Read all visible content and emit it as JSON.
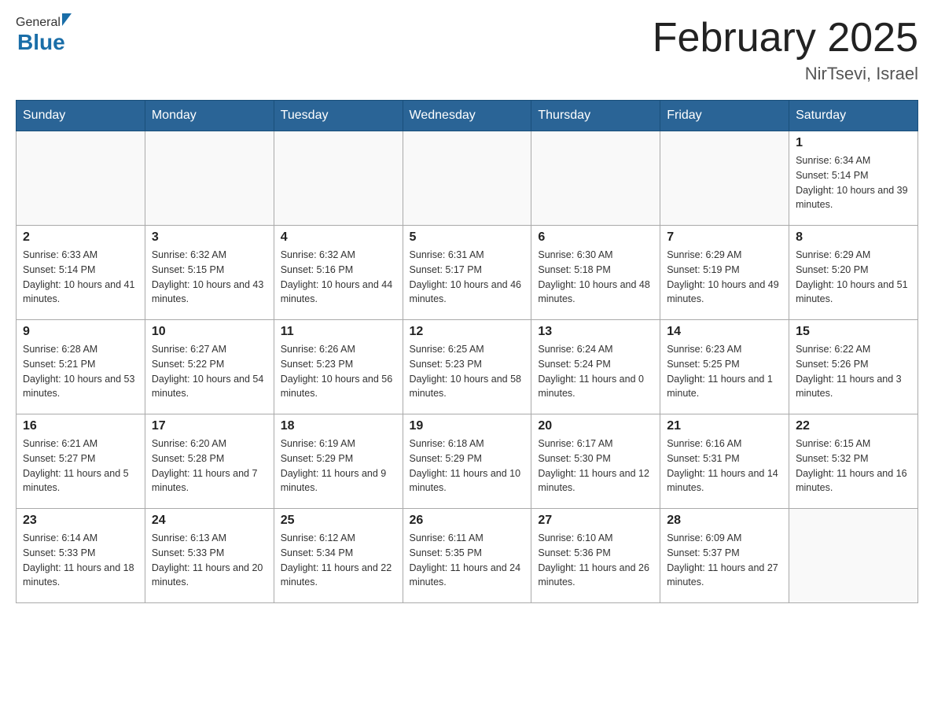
{
  "header": {
    "title": "February 2025",
    "subtitle": "NirTsevi, Israel",
    "logo_general": "General",
    "logo_blue": "Blue"
  },
  "weekdays": [
    "Sunday",
    "Monday",
    "Tuesday",
    "Wednesday",
    "Thursday",
    "Friday",
    "Saturday"
  ],
  "weeks": [
    [
      {
        "day": "",
        "sunrise": "",
        "sunset": "",
        "daylight": ""
      },
      {
        "day": "",
        "sunrise": "",
        "sunset": "",
        "daylight": ""
      },
      {
        "day": "",
        "sunrise": "",
        "sunset": "",
        "daylight": ""
      },
      {
        "day": "",
        "sunrise": "",
        "sunset": "",
        "daylight": ""
      },
      {
        "day": "",
        "sunrise": "",
        "sunset": "",
        "daylight": ""
      },
      {
        "day": "",
        "sunrise": "",
        "sunset": "",
        "daylight": ""
      },
      {
        "day": "1",
        "sunrise": "Sunrise: 6:34 AM",
        "sunset": "Sunset: 5:14 PM",
        "daylight": "Daylight: 10 hours and 39 minutes."
      }
    ],
    [
      {
        "day": "2",
        "sunrise": "Sunrise: 6:33 AM",
        "sunset": "Sunset: 5:14 PM",
        "daylight": "Daylight: 10 hours and 41 minutes."
      },
      {
        "day": "3",
        "sunrise": "Sunrise: 6:32 AM",
        "sunset": "Sunset: 5:15 PM",
        "daylight": "Daylight: 10 hours and 43 minutes."
      },
      {
        "day": "4",
        "sunrise": "Sunrise: 6:32 AM",
        "sunset": "Sunset: 5:16 PM",
        "daylight": "Daylight: 10 hours and 44 minutes."
      },
      {
        "day": "5",
        "sunrise": "Sunrise: 6:31 AM",
        "sunset": "Sunset: 5:17 PM",
        "daylight": "Daylight: 10 hours and 46 minutes."
      },
      {
        "day": "6",
        "sunrise": "Sunrise: 6:30 AM",
        "sunset": "Sunset: 5:18 PM",
        "daylight": "Daylight: 10 hours and 48 minutes."
      },
      {
        "day": "7",
        "sunrise": "Sunrise: 6:29 AM",
        "sunset": "Sunset: 5:19 PM",
        "daylight": "Daylight: 10 hours and 49 minutes."
      },
      {
        "day": "8",
        "sunrise": "Sunrise: 6:29 AM",
        "sunset": "Sunset: 5:20 PM",
        "daylight": "Daylight: 10 hours and 51 minutes."
      }
    ],
    [
      {
        "day": "9",
        "sunrise": "Sunrise: 6:28 AM",
        "sunset": "Sunset: 5:21 PM",
        "daylight": "Daylight: 10 hours and 53 minutes."
      },
      {
        "day": "10",
        "sunrise": "Sunrise: 6:27 AM",
        "sunset": "Sunset: 5:22 PM",
        "daylight": "Daylight: 10 hours and 54 minutes."
      },
      {
        "day": "11",
        "sunrise": "Sunrise: 6:26 AM",
        "sunset": "Sunset: 5:23 PM",
        "daylight": "Daylight: 10 hours and 56 minutes."
      },
      {
        "day": "12",
        "sunrise": "Sunrise: 6:25 AM",
        "sunset": "Sunset: 5:23 PM",
        "daylight": "Daylight: 10 hours and 58 minutes."
      },
      {
        "day": "13",
        "sunrise": "Sunrise: 6:24 AM",
        "sunset": "Sunset: 5:24 PM",
        "daylight": "Daylight: 11 hours and 0 minutes."
      },
      {
        "day": "14",
        "sunrise": "Sunrise: 6:23 AM",
        "sunset": "Sunset: 5:25 PM",
        "daylight": "Daylight: 11 hours and 1 minute."
      },
      {
        "day": "15",
        "sunrise": "Sunrise: 6:22 AM",
        "sunset": "Sunset: 5:26 PM",
        "daylight": "Daylight: 11 hours and 3 minutes."
      }
    ],
    [
      {
        "day": "16",
        "sunrise": "Sunrise: 6:21 AM",
        "sunset": "Sunset: 5:27 PM",
        "daylight": "Daylight: 11 hours and 5 minutes."
      },
      {
        "day": "17",
        "sunrise": "Sunrise: 6:20 AM",
        "sunset": "Sunset: 5:28 PM",
        "daylight": "Daylight: 11 hours and 7 minutes."
      },
      {
        "day": "18",
        "sunrise": "Sunrise: 6:19 AM",
        "sunset": "Sunset: 5:29 PM",
        "daylight": "Daylight: 11 hours and 9 minutes."
      },
      {
        "day": "19",
        "sunrise": "Sunrise: 6:18 AM",
        "sunset": "Sunset: 5:29 PM",
        "daylight": "Daylight: 11 hours and 10 minutes."
      },
      {
        "day": "20",
        "sunrise": "Sunrise: 6:17 AM",
        "sunset": "Sunset: 5:30 PM",
        "daylight": "Daylight: 11 hours and 12 minutes."
      },
      {
        "day": "21",
        "sunrise": "Sunrise: 6:16 AM",
        "sunset": "Sunset: 5:31 PM",
        "daylight": "Daylight: 11 hours and 14 minutes."
      },
      {
        "day": "22",
        "sunrise": "Sunrise: 6:15 AM",
        "sunset": "Sunset: 5:32 PM",
        "daylight": "Daylight: 11 hours and 16 minutes."
      }
    ],
    [
      {
        "day": "23",
        "sunrise": "Sunrise: 6:14 AM",
        "sunset": "Sunset: 5:33 PM",
        "daylight": "Daylight: 11 hours and 18 minutes."
      },
      {
        "day": "24",
        "sunrise": "Sunrise: 6:13 AM",
        "sunset": "Sunset: 5:33 PM",
        "daylight": "Daylight: 11 hours and 20 minutes."
      },
      {
        "day": "25",
        "sunrise": "Sunrise: 6:12 AM",
        "sunset": "Sunset: 5:34 PM",
        "daylight": "Daylight: 11 hours and 22 minutes."
      },
      {
        "day": "26",
        "sunrise": "Sunrise: 6:11 AM",
        "sunset": "Sunset: 5:35 PM",
        "daylight": "Daylight: 11 hours and 24 minutes."
      },
      {
        "day": "27",
        "sunrise": "Sunrise: 6:10 AM",
        "sunset": "Sunset: 5:36 PM",
        "daylight": "Daylight: 11 hours and 26 minutes."
      },
      {
        "day": "28",
        "sunrise": "Sunrise: 6:09 AM",
        "sunset": "Sunset: 5:37 PM",
        "daylight": "Daylight: 11 hours and 27 minutes."
      },
      {
        "day": "",
        "sunrise": "",
        "sunset": "",
        "daylight": ""
      }
    ]
  ]
}
